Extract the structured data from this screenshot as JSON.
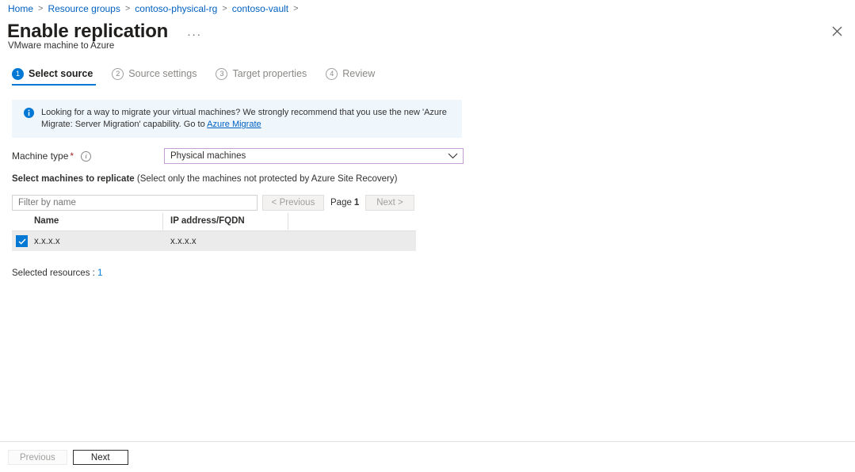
{
  "breadcrumb": {
    "items": [
      {
        "label": "Home"
      },
      {
        "label": "Resource groups"
      },
      {
        "label": "contoso-physical-rg"
      },
      {
        "label": "contoso-vault"
      }
    ],
    "separator": ">"
  },
  "header": {
    "title": "Enable replication",
    "subtitle": "VMware machine to Azure",
    "ellipsis": "···",
    "close_icon": "close-icon"
  },
  "steps": [
    {
      "num": "1",
      "label": "Select source",
      "state": "active"
    },
    {
      "num": "2",
      "label": "Source settings",
      "state": "inactive"
    },
    {
      "num": "3",
      "label": "Target properties",
      "state": "inactive"
    },
    {
      "num": "4",
      "label": "Review",
      "state": "inactive"
    }
  ],
  "banner": {
    "icon": "info-circle-filled-icon",
    "text_before": "Looking for a way to migrate your virtual machines? We strongly recommend that you use the new 'Azure Migrate: Server Migration' capability. Go to ",
    "link_text": "Azure Migrate",
    "background": "#eff6fc",
    "icon_color": "#0078d4"
  },
  "machine_type": {
    "label": "Machine type",
    "required_mark": "*",
    "info_icon": "info-circle-outline-icon",
    "selected_value": "Physical machines",
    "chevron_icon": "chevron-down-icon",
    "border_color": "#c4a0d2"
  },
  "section": {
    "heading_bold": "Select machines to replicate",
    "heading_note": " (Select only the machines not protected by Azure Site Recovery)"
  },
  "toolbar": {
    "filter_placeholder": "Filter by name",
    "filter_value": "",
    "previous_label": "< Previous",
    "next_label": "Next >",
    "page_text": "Page",
    "page_number": "1"
  },
  "table": {
    "columns": [
      "Name",
      "IP address/FQDN",
      ""
    ],
    "rows": [
      {
        "checked": true,
        "name": "x.x.x.x",
        "ip": "x.x.x.x",
        "extra": ""
      }
    ],
    "selected_row_bg": "#ebebeb",
    "checkbox_color": "#0078d4"
  },
  "selected_resources": {
    "label": "Selected resources :",
    "count": "1",
    "count_color": "#0078d4"
  },
  "footer": {
    "previous_label": "Previous",
    "next_label": "Next"
  },
  "colors": {
    "accent": "#0078d4",
    "link": "#0060c0",
    "required": "#a4262c"
  }
}
